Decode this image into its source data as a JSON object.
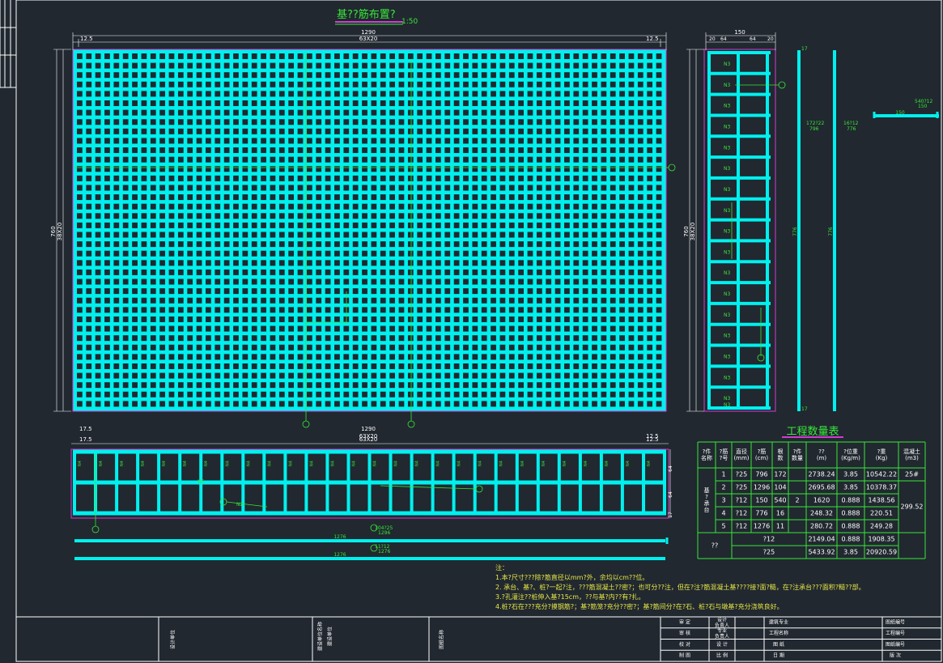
{
  "plan": {
    "title": "基??筋布置?",
    "scale": "1:50",
    "dim_top_total": "1290",
    "dim_top_left": "12.5",
    "dim_top_mid": "63X20",
    "dim_top_right": "12.5",
    "dim_left_total": "760",
    "dim_left_mid": "38X20",
    "dim_bottom_total": "1290",
    "dim_bottom_left": "17.5",
    "dim_bottom_mid": "63X20",
    "dim_bottom_right": "12.5"
  },
  "side_view": {
    "dim_top": "150",
    "dim_top_a": "20",
    "dim_top_b": "64",
    "dim_top_c": "64",
    "dim_top_d": "20",
    "dim_left_total": "760",
    "dim_left_mid": "38X20",
    "row_labels": [
      "N3",
      "N3",
      "N3",
      "N3",
      "N3",
      "N3",
      "N3",
      "N3",
      "N3",
      "N3",
      "N3",
      "N3",
      "N3",
      "N3",
      "N3",
      "N3",
      "N3"
    ],
    "bottom_label": "N3"
  },
  "bar_details": {
    "bar1_len": "776",
    "bar1_label_a": "172?22",
    "bar1_label_b": "796",
    "bar2_len": "776",
    "bar2_label_a": "16?12",
    "bar2_label_b": "776",
    "bar3_len": "150",
    "bar3_label_a": "540?12",
    "bar3_label_b": "150",
    "bar4_len": "1276",
    "bar4_label_a": "104?25",
    "bar4_label_b": "1296",
    "bar5_len": "1276",
    "bar5_label_a": "11?12",
    "bar5_label_b": "1276",
    "leg_a": "17",
    "leg_b": "17"
  },
  "section": {
    "dim_left": "17.5",
    "dim_mid": "63X20",
    "dim_total": "1290",
    "dim_right": "12.5",
    "dim_r1": "64",
    "dim_r2": "64",
    "dim_r3": "17",
    "col_labels": [
      "N4",
      "N4",
      "N4",
      "N4",
      "N4",
      "N4",
      "N4",
      "N4",
      "N4",
      "N4",
      "N4",
      "N4",
      "N4",
      "N4",
      "N4",
      "N4",
      "N4",
      "N4",
      "N4",
      "N4",
      "N4",
      "N4",
      "N4",
      "N4",
      "N4",
      "N4",
      "N4",
      "N4"
    ],
    "label_n5": "N5",
    "label_n2": "N2"
  },
  "quantity_table": {
    "title": "工程数量表",
    "headers": {
      "part": "?件\n名称",
      "no": "?筋\n?号",
      "dia": "直径\n(mm)",
      "len": "?筋\n(cm)",
      "count": "根\n数",
      "pieces": "?件\n数量",
      "total_len": "??\n(m)",
      "unit_wt": "?位重\n(Kg/m)",
      "weight": "?重\n(Kg)",
      "concrete": "混凝土\n(m3)"
    },
    "part_name": "基\n?\n承\n台",
    "pieces": "2",
    "concrete_top": "25#",
    "concrete_value": "299.52",
    "rows": [
      {
        "no": "1",
        "dia": "?25",
        "len": "796",
        "count": "172",
        "total_len": "2738.24",
        "unit_wt": "3.85",
        "weight": "10542.22"
      },
      {
        "no": "2",
        "dia": "?25",
        "len": "1296",
        "count": "104",
        "total_len": "2695.68",
        "unit_wt": "3.85",
        "weight": "10378.37"
      },
      {
        "no": "3",
        "dia": "?12",
        "len": "150",
        "count": "540",
        "total_len": "1620",
        "unit_wt": "0.888",
        "weight": "1438.56"
      },
      {
        "no": "4",
        "dia": "?12",
        "len": "776",
        "count": "16",
        "total_len": "248.32",
        "unit_wt": "0.888",
        "weight": "220.51"
      },
      {
        "no": "5",
        "dia": "?12",
        "len": "1276",
        "count": "11",
        "total_len": "280.72",
        "unit_wt": "0.888",
        "weight": "249.28"
      }
    ],
    "sum_label": "??",
    "sums": [
      {
        "dia": "?12",
        "total_len": "2149.04",
        "unit_wt": "0.888",
        "weight": "1908.35"
      },
      {
        "dia": "?25",
        "total_len": "5433.92",
        "unit_wt": "3.85",
        "weight": "20920.59"
      }
    ]
  },
  "notes": {
    "heading": "注：",
    "lines": [
      "1.本?尺寸???除?筋直径以mm?外，余均以cm??位。",
      "2. 承台、基?、桩?一起?注，???筋混凝土??密?；也可分??注，但在?注?筋混凝土基????接?面?糙，在?注承台???面积?糙??部。",
      "3.?孔灌注??桩伸入基?15cm，??与基?内??有?扎。",
      "4.桩?石在???充分?摸钢筋?；基?筋笼?充分??密?；基?筋间分?在?石、桩?石与墩基?充分浇筑良好。"
    ]
  },
  "title_block": {
    "col1": "设计单位",
    "col2": "建设单位名称",
    "col2b": "建设单位",
    "col3": "图纸名称",
    "cells": [
      {
        "a": "审 定",
        "b": "设计\n负责人",
        "c": "建筑专业",
        "d": "图纸编号"
      },
      {
        "a": "审 核",
        "b": "专业\n负责人",
        "c": "工程名称",
        "d": "工程编号"
      },
      {
        "a": "校 对",
        "b": "设 计",
        "c": "图 纸",
        "d": "图纸编号"
      },
      {
        "a": "制 图",
        "b": "比 例",
        "c": "日 期",
        "d": "版 次"
      }
    ]
  },
  "colors": {
    "background": "#212830",
    "rebar": "#00f0ee",
    "frame": "#ffffff",
    "dimension": "#ffffff",
    "annotation": "#39e639",
    "highlight": "#d23bd2",
    "note_text": "#e8e845"
  }
}
